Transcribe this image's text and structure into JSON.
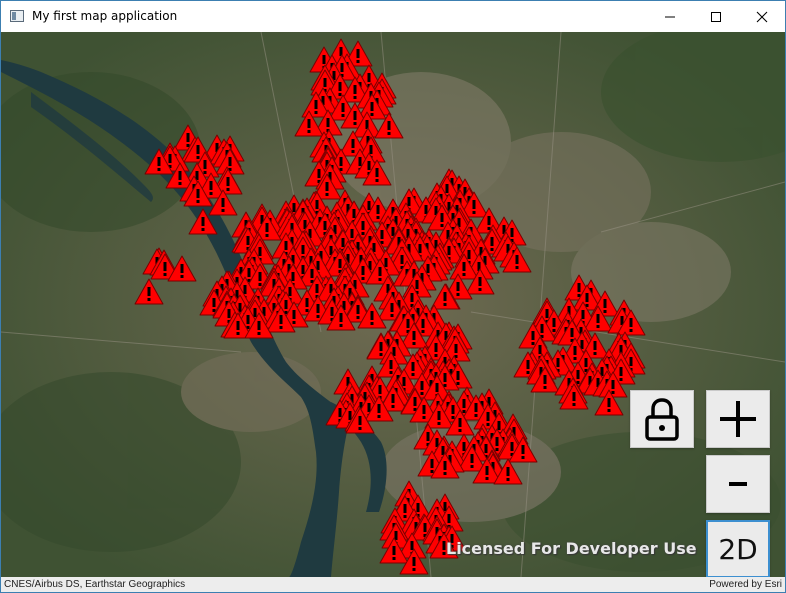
{
  "window": {
    "title": "My first map application",
    "minimize_icon": "minimize-icon",
    "maximize_icon": "maximize-icon",
    "close_icon": "close-icon"
  },
  "map": {
    "license_text": "Licensed For Developer Use",
    "attribution_left": "CNES/Airbus DS, Earthstar Geographics",
    "attribution_right": "Powered by Esri",
    "marker_icon": "warning-triangle-icon",
    "marker_color": "#ff0000",
    "river_color": "#1f3a40"
  },
  "controls": {
    "lock_icon": "lock-icon",
    "zoom_in_label": "+",
    "zoom_out_label": "-",
    "view_mode_label": "2D"
  }
}
